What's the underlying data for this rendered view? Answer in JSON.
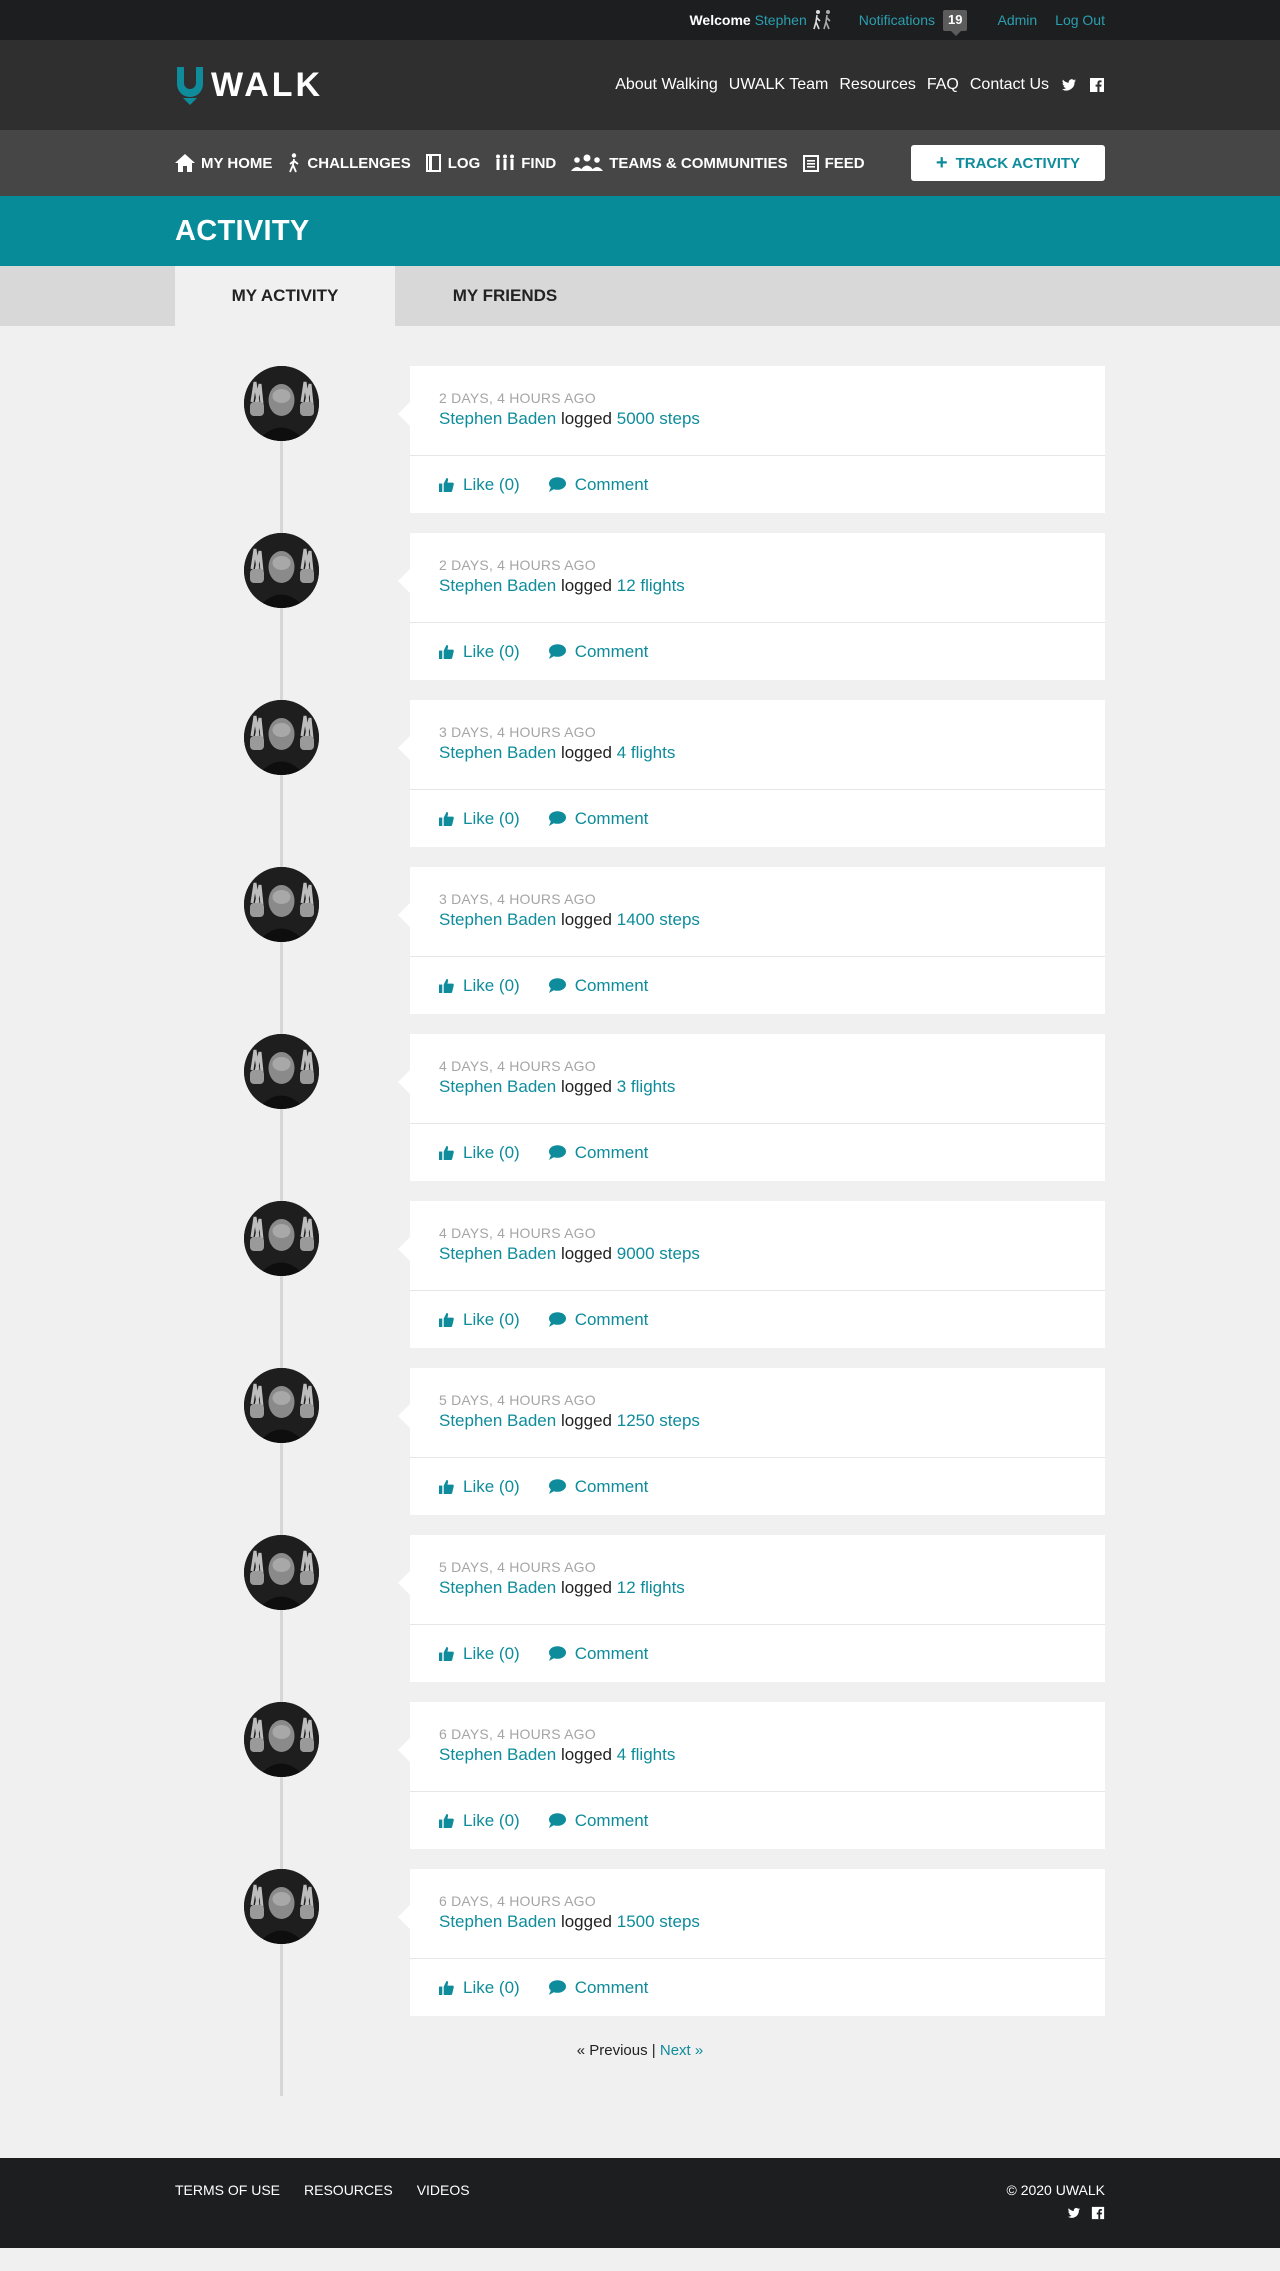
{
  "topbar": {
    "welcome_label": "Welcome",
    "user_name": "Stephen",
    "notifications_label": "Notifications",
    "notifications_count": "19",
    "admin_label": "Admin",
    "logout_label": "Log Out"
  },
  "header": {
    "logo_text": "WALK",
    "nav": [
      "About Walking",
      "UWALK Team",
      "Resources",
      "FAQ",
      "Contact Us"
    ]
  },
  "navbar": {
    "items": [
      {
        "label": "MY HOME",
        "icon": "home-icon"
      },
      {
        "label": "CHALLENGES",
        "icon": "walker-icon"
      },
      {
        "label": "LOG",
        "icon": "book-icon"
      },
      {
        "label": "FIND",
        "icon": "people-icon"
      },
      {
        "label": "TEAMS & COMMUNITIES",
        "icon": "group-icon"
      },
      {
        "label": "FEED",
        "icon": "feed-icon"
      }
    ],
    "track_label": "TRACK ACTIVITY"
  },
  "page": {
    "title": "ACTIVITY",
    "tabs": [
      "MY ACTIVITY",
      "MY FRIENDS"
    ]
  },
  "feed": {
    "entries": [
      {
        "time": "2 DAYS, 4 HOURS AGO",
        "user": "Stephen Baden",
        "verb": "logged",
        "amount": "5000 steps",
        "like": "Like (0)",
        "comment": "Comment"
      },
      {
        "time": "2 DAYS, 4 HOURS AGO",
        "user": "Stephen Baden",
        "verb": "logged",
        "amount": "12 flights",
        "like": "Like (0)",
        "comment": "Comment"
      },
      {
        "time": "3 DAYS, 4 HOURS AGO",
        "user": "Stephen Baden",
        "verb": "logged",
        "amount": "4 flights",
        "like": "Like (0)",
        "comment": "Comment"
      },
      {
        "time": "3 DAYS, 4 HOURS AGO",
        "user": "Stephen Baden",
        "verb": "logged",
        "amount": "1400 steps",
        "like": "Like (0)",
        "comment": "Comment"
      },
      {
        "time": "4 DAYS, 4 HOURS AGO",
        "user": "Stephen Baden",
        "verb": "logged",
        "amount": "3 flights",
        "like": "Like (0)",
        "comment": "Comment"
      },
      {
        "time": "4 DAYS, 4 HOURS AGO",
        "user": "Stephen Baden",
        "verb": "logged",
        "amount": "9000 steps",
        "like": "Like (0)",
        "comment": "Comment"
      },
      {
        "time": "5 DAYS, 4 HOURS AGO",
        "user": "Stephen Baden",
        "verb": "logged",
        "amount": "1250 steps",
        "like": "Like (0)",
        "comment": "Comment"
      },
      {
        "time": "5 DAYS, 4 HOURS AGO",
        "user": "Stephen Baden",
        "verb": "logged",
        "amount": "12 flights",
        "like": "Like (0)",
        "comment": "Comment"
      },
      {
        "time": "6 DAYS, 4 HOURS AGO",
        "user": "Stephen Baden",
        "verb": "logged",
        "amount": "4 flights",
        "like": "Like (0)",
        "comment": "Comment"
      },
      {
        "time": "6 DAYS, 4 HOURS AGO",
        "user": "Stephen Baden",
        "verb": "logged",
        "amount": "1500 steps",
        "like": "Like (0)",
        "comment": "Comment"
      }
    ]
  },
  "pager": {
    "previous": "« Previous",
    "separator": "|",
    "next": "Next »"
  },
  "footer": {
    "links": [
      "TERMS OF USE",
      "RESOURCES",
      "VIDEOS"
    ],
    "copyright": "© 2020 UWALK"
  },
  "colors": {
    "accent": "#078b99",
    "link": "#0e8c9b",
    "topbar": "#1d1e1f"
  }
}
